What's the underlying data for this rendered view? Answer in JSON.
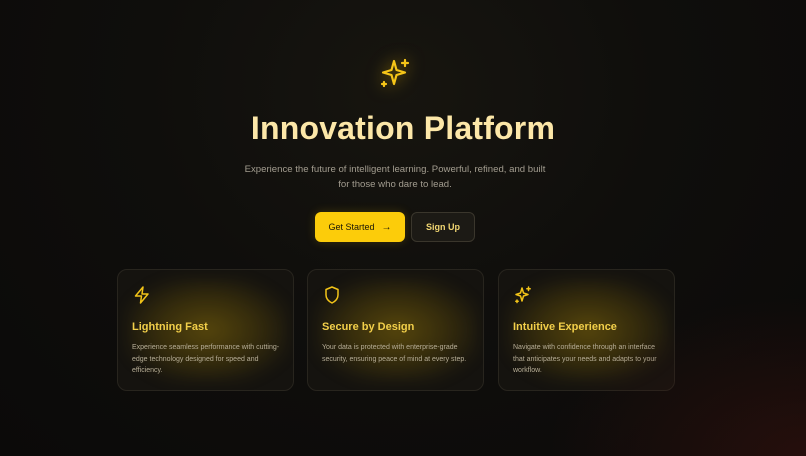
{
  "hero": {
    "icon": "sparkles-icon",
    "title": "Innovation Platform",
    "subtitle": "Experience the future of intelligent learning. Powerful, refined, and built for those who dare to lead."
  },
  "actions": {
    "primary_label": "Get Started",
    "primary_icon": "arrow-right-icon",
    "secondary_label": "Sign Up"
  },
  "features": [
    {
      "icon": "lightning-icon",
      "title": "Lightning Fast",
      "description": "Experience seamless performance with cutting-edge technology designed for speed and efficiency."
    },
    {
      "icon": "shield-icon",
      "title": "Secure by Design",
      "description": "Your data is protected with enterprise-grade security, ensuring peace of mind at every step."
    },
    {
      "icon": "sparkles-icon",
      "title": "Intuitive Experience",
      "description": "Navigate with confidence through an interface that anticipates your needs and adapts to your workflow."
    }
  ],
  "colors": {
    "accent": "#fccc0a",
    "title": "#fce7a8",
    "background": "#0f0e0c"
  }
}
